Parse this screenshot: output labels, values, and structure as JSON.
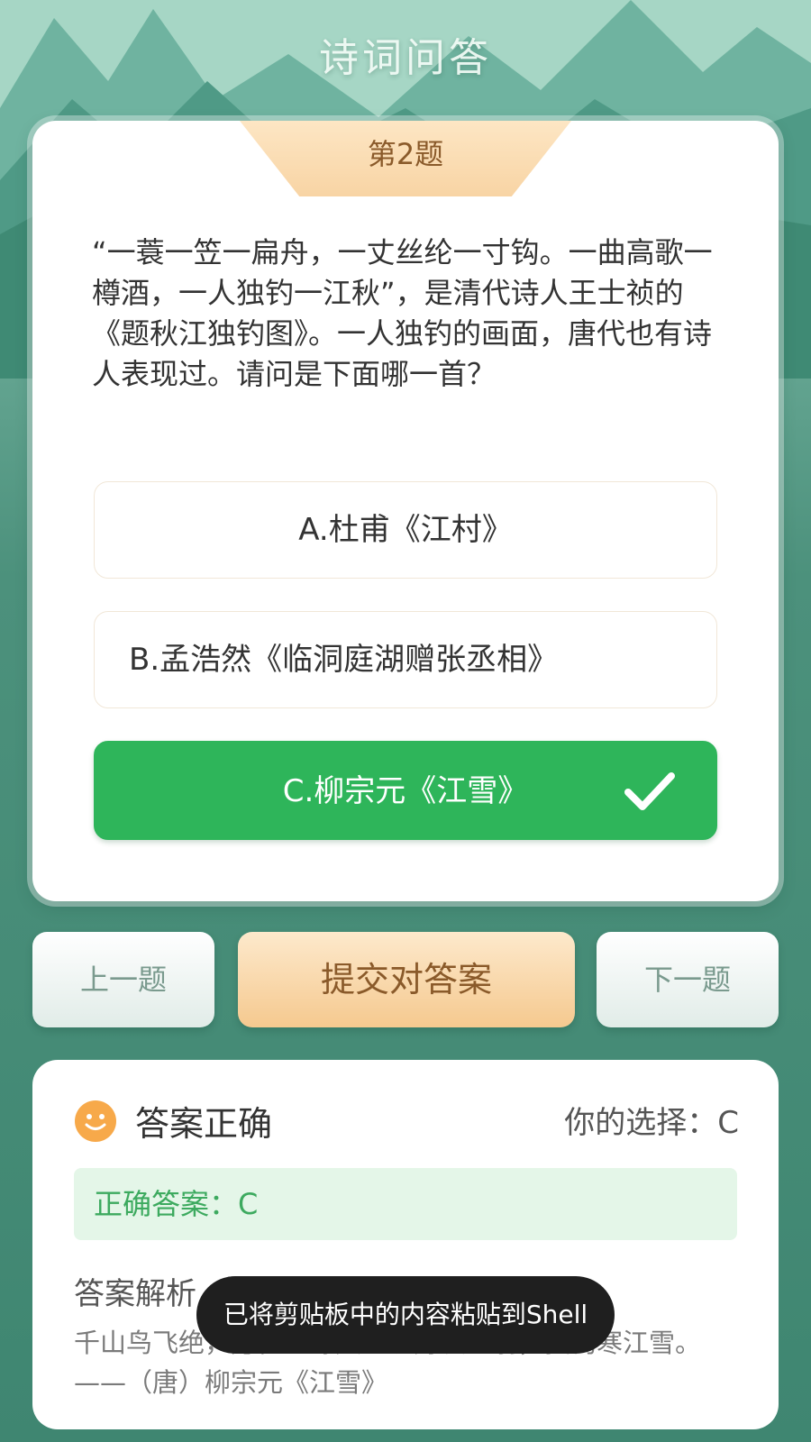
{
  "header": {
    "title": "诗词问答"
  },
  "question": {
    "number_label": "第2题",
    "text": "“一蓑一笠一扁舟，一丈丝纶一寸钩。一曲高歌一樽酒，一人独钓一江秋”，是清代诗人王士祯的《题秋江独钓图》。一人独钓的画面，唐代也有诗人表现过。请问是下面哪一首？",
    "options": [
      {
        "label": "A.杜甫《江村》",
        "selected": false
      },
      {
        "label": "B.孟浩然《临洞庭湖赠张丞相》",
        "selected": false
      },
      {
        "label": "C.柳宗元《江雪》",
        "selected": true
      }
    ]
  },
  "buttons": {
    "prev": "上一题",
    "submit": "提交对答案",
    "next": "下一题"
  },
  "result": {
    "status": "答案正确",
    "your_choice": "你的选择：C",
    "correct_answer": "正确答案：C",
    "analysis_title": "答案解析",
    "analysis_text": "千山鸟飞绝，万径人踪灭。孤舟蓑笠翁，独钓寒江雪。——（唐）柳宗元《江雪》"
  },
  "toast": "已将剪贴板中的内容粘贴到Shell",
  "colors": {
    "accent_green": "#2eb55a",
    "tag_orange": "#f8d4a4",
    "background": "#4c917c"
  }
}
